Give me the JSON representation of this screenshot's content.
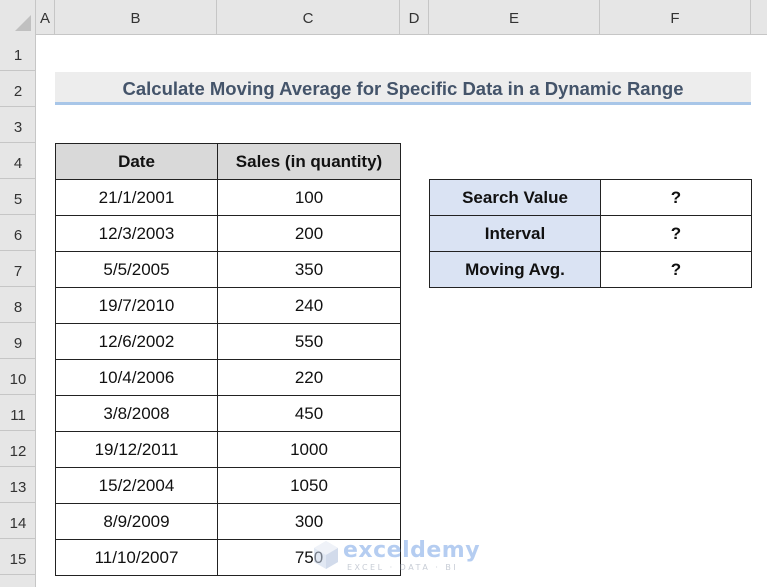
{
  "spreadsheet": {
    "columns": [
      "A",
      "B",
      "C",
      "D",
      "E",
      "F"
    ],
    "rows": [
      "1",
      "2",
      "3",
      "4",
      "5",
      "6",
      "7",
      "8",
      "9",
      "10",
      "11",
      "12",
      "13",
      "14",
      "15"
    ]
  },
  "title": "Calculate Moving Average for Specific Data in a Dynamic Range",
  "data_table": {
    "headers": [
      "Date",
      "Sales (in quantity)"
    ],
    "rows": [
      {
        "date": "21/1/2001",
        "sales": "100"
      },
      {
        "date": "12/3/2003",
        "sales": "200"
      },
      {
        "date": "5/5/2005",
        "sales": "350"
      },
      {
        "date": "19/7/2010",
        "sales": "240"
      },
      {
        "date": "12/6/2002",
        "sales": "550"
      },
      {
        "date": "10/4/2006",
        "sales": "220"
      },
      {
        "date": "3/8/2008",
        "sales": "450"
      },
      {
        "date": "19/12/2011",
        "sales": "1000"
      },
      {
        "date": "15/2/2004",
        "sales": "1050"
      },
      {
        "date": "8/9/2009",
        "sales": "300"
      },
      {
        "date": "11/10/2007",
        "sales": "750"
      }
    ]
  },
  "lookup_table": {
    "rows": [
      {
        "label": "Search Value",
        "value": "?"
      },
      {
        "label": "Interval",
        "value": "?"
      },
      {
        "label": "Moving Avg.",
        "value": "?"
      }
    ]
  },
  "watermark": {
    "brand": "exceldemy",
    "tagline": "EXCEL · DATA · BI",
    "icon": "exceldemy-logo-icon"
  },
  "colors": {
    "title_text": "#44546a",
    "title_underline": "#a8c6e8",
    "header_fill": "#d9d9d9",
    "lookup_label_fill": "#dae3f3"
  }
}
